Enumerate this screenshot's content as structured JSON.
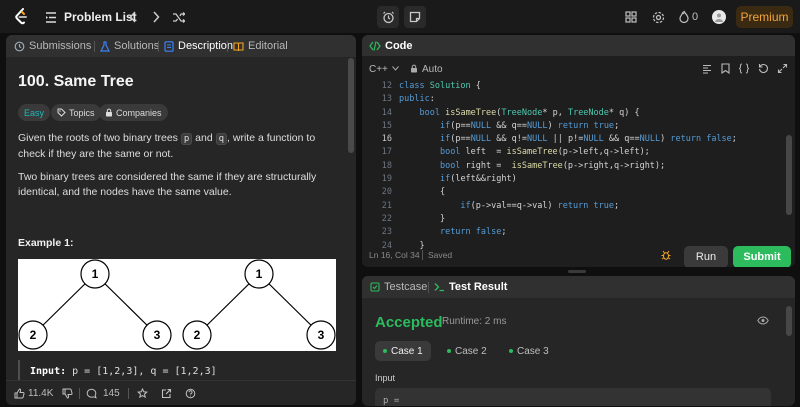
{
  "topbar": {
    "title": "Problem List",
    "premium": "Premium",
    "streak": "0"
  },
  "left_tabs": {
    "submissions": "Submissions",
    "solutions": "Solutions",
    "description": "Description",
    "editorial": "Editorial"
  },
  "problem": {
    "title": "100. Same Tree",
    "difficulty": "Easy",
    "topics": "Topics",
    "companies": "Companies",
    "desc1_a": "Given the roots of two binary trees ",
    "desc1_p": "p",
    "desc1_b": " and ",
    "desc1_q": "q",
    "desc1_c": ", write a function to check if they are the same or not.",
    "desc2": "Two binary trees are considered the same if they are structurally identical, and the nodes have the same value.",
    "example_title": "Example 1:",
    "example_input_label": "Input:",
    "example_input_value": " p = [1,2,3], q = [1,2,3]",
    "tree_nodes": [
      "1",
      "2",
      "3",
      "1",
      "2",
      "3"
    ]
  },
  "left_footer": {
    "likes": "11.4K",
    "comments": "145"
  },
  "code": {
    "header": "Code",
    "language": "C++",
    "auto": "Auto",
    "line_numbers": [
      "12",
      "13",
      "14",
      "15",
      "16",
      "17",
      "18",
      "19",
      "20",
      "21",
      "22",
      "23",
      "24"
    ],
    "status_pos": "Ln 16, Col 34",
    "status_saved": "Saved",
    "run": "Run",
    "submit": "Submit"
  },
  "test": {
    "tab_testcase": "Testcase",
    "tab_result": "Test Result",
    "status": "Accepted",
    "runtime": "Runtime: 2 ms",
    "cases": [
      "Case 1",
      "Case 2",
      "Case 3"
    ],
    "input_label": "Input",
    "input_value": "p ="
  },
  "colors": {
    "accent_green": "#2cbb5d",
    "easy_teal": "#1cbaba",
    "premium_orange": "#f3a43b"
  }
}
